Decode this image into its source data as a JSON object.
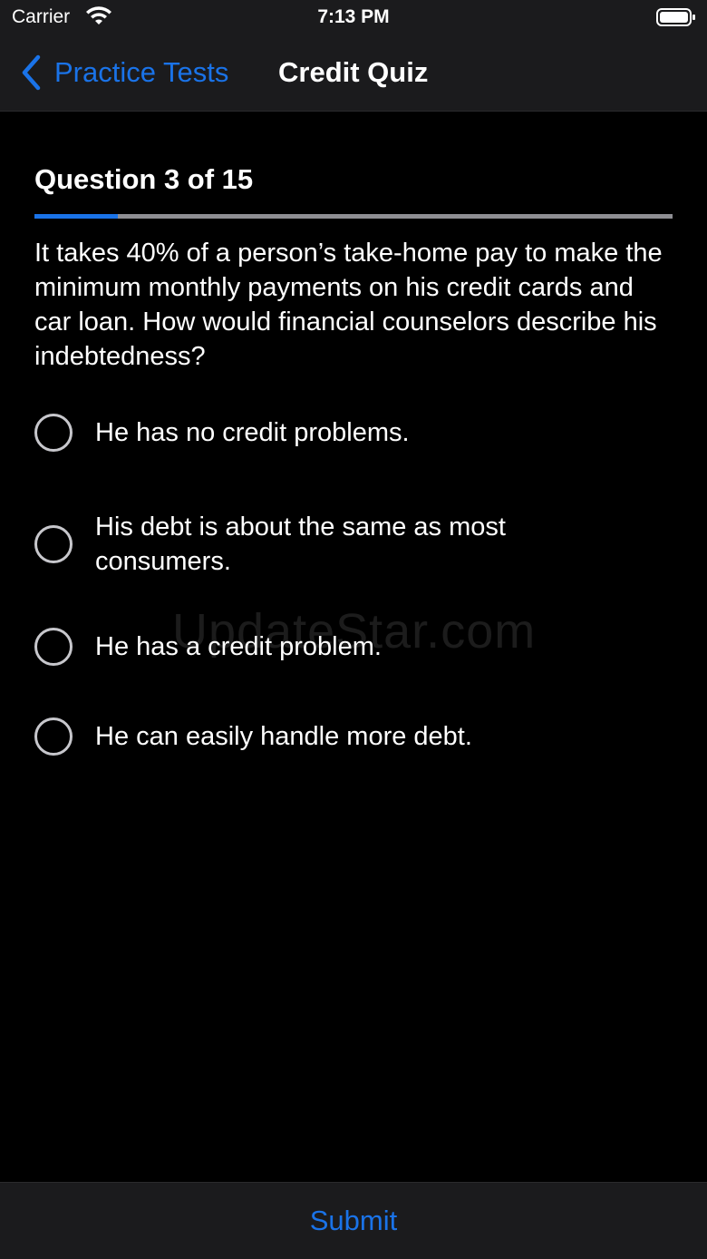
{
  "status_bar": {
    "carrier": "Carrier",
    "time": "7:13 PM"
  },
  "nav": {
    "back_label": "Practice Tests",
    "title": "Credit Quiz"
  },
  "quiz": {
    "counter": "Question 3 of 15",
    "progress_fraction": 0.13,
    "question": "It takes 40% of a person’s take-home pay to make the minimum monthly payments on his credit cards and car loan. How would financial counselors describe his indebtedness?",
    "options": [
      {
        "label": "He has no credit problems."
      },
      {
        "label": "His debt is about the same as most consumers."
      },
      {
        "label": "He has a credit problem."
      },
      {
        "label": "He can easily handle more debt."
      }
    ]
  },
  "watermark": "UpdateStar.com",
  "footer": {
    "submit_label": "Submit"
  },
  "colors": {
    "accent": "#1a73e8",
    "background": "#000000",
    "bar": "#1b1b1d"
  },
  "icons": [
    "wifi-icon",
    "battery-icon",
    "chevron-left-icon"
  ]
}
